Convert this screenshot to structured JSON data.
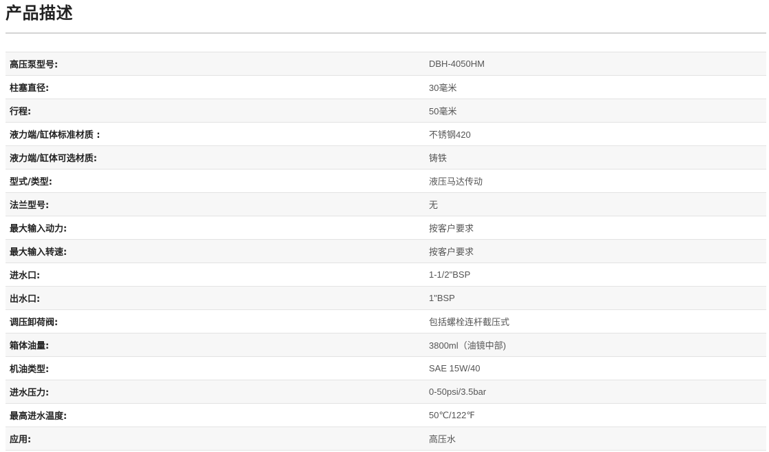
{
  "section": {
    "title": "产品描述"
  },
  "specs": [
    {
      "label": "高压泵型号:",
      "value": "DBH-4050HM"
    },
    {
      "label": "柱塞直径:",
      "value": "30毫米"
    },
    {
      "label": "行程:",
      "value": "50毫米"
    },
    {
      "label": "液力端/缸体标准材质 :",
      "value": "不锈钢420"
    },
    {
      "label": "液力端/缸体可选材质:",
      "value": "铸铁"
    },
    {
      "label": "型式/类型:",
      "value": "液压马达传动"
    },
    {
      "label": "法兰型号:",
      "value": "无"
    },
    {
      "label": "最大输入动力:",
      "value": "按客户要求"
    },
    {
      "label": "最大输入转速:",
      "value": "按客户要求"
    },
    {
      "label": "进水口:",
      "value": "1-1/2\"BSP"
    },
    {
      "label": "出水口:",
      "value": "1\"BSP"
    },
    {
      "label": "调压卸荷阀:",
      "value": "包括螺栓连杆截压式"
    },
    {
      "label": "箱体油量:",
      "value": "3800ml（油镜中部)"
    },
    {
      "label": "机油类型:",
      "value": "SAE 15W/40"
    },
    {
      "label": "进水压力:",
      "value": "0-50psi/3.5bar"
    },
    {
      "label": "最高进水温度:",
      "value": "50℃/122℉"
    },
    {
      "label": "应用:",
      "value": "高压水"
    }
  ]
}
